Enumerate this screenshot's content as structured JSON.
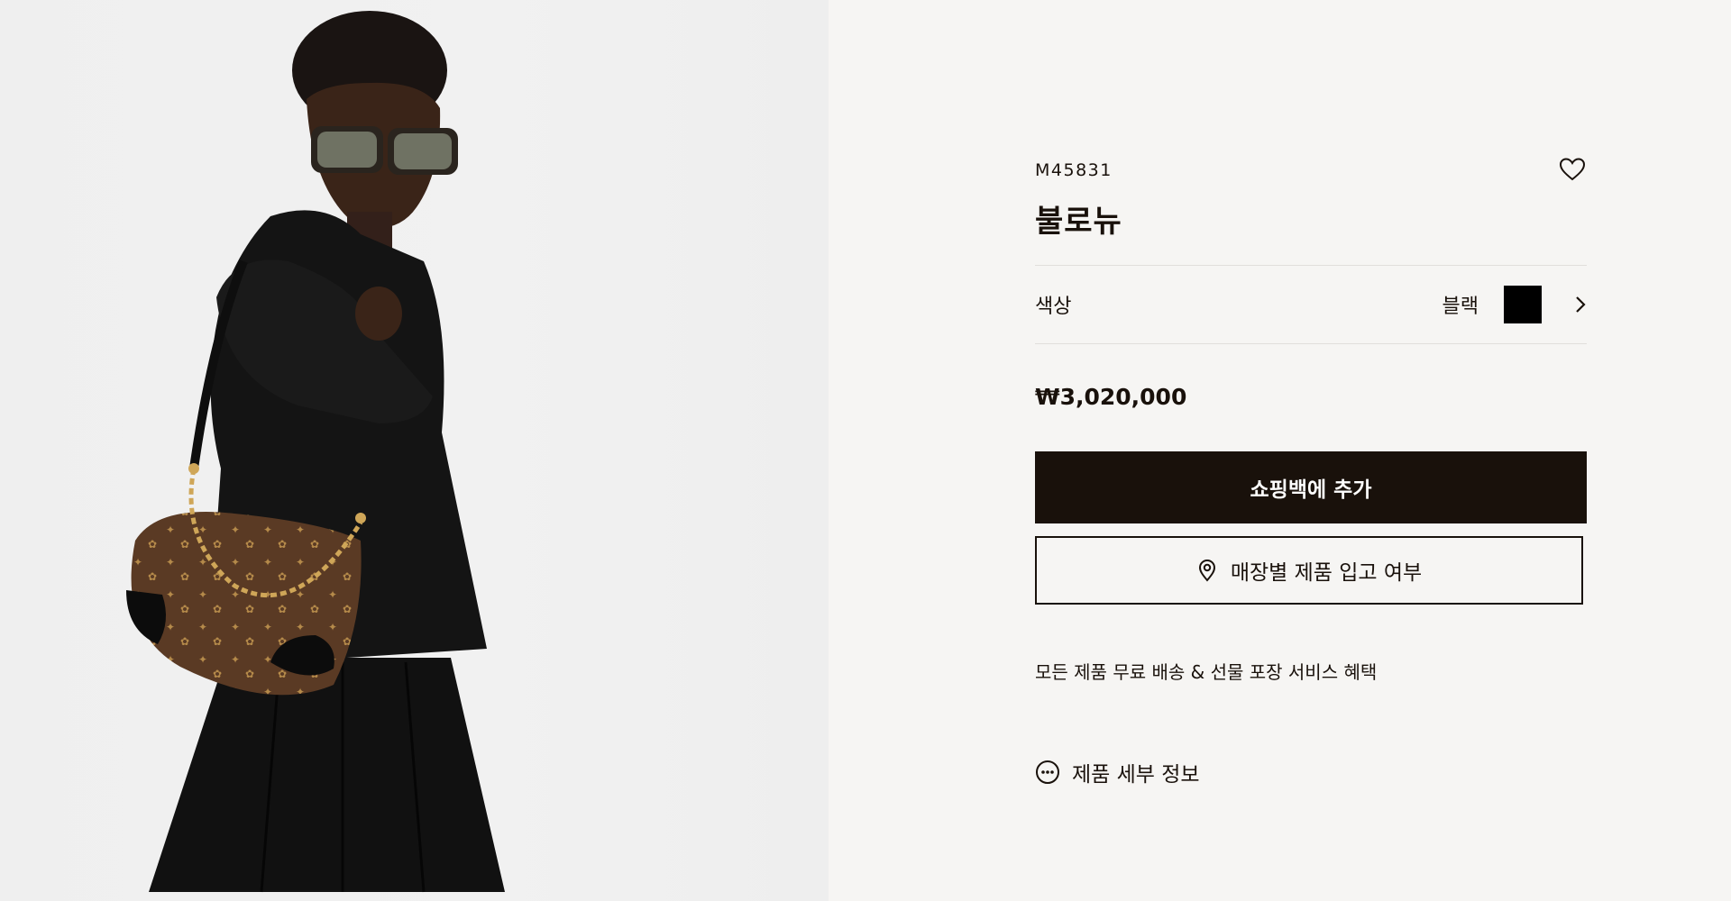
{
  "product": {
    "sku": "M45831",
    "name": "불로뉴",
    "color_label": "색상",
    "color_value": "블랙",
    "color_swatch": "#000000",
    "price": "₩3,020,000",
    "add_to_bag_label": "쇼핑백에 추가",
    "store_availability_label": "매장별 제품 입고 여부",
    "perks_text": "모든 제품 무료 배송 & 선물 포장 서비스 혜택",
    "details_label": "제품 세부 정보"
  },
  "icons": {
    "wishlist": "heart-icon",
    "color_next": "chevron-right-icon",
    "store": "location-pin-icon",
    "details": "more-dots-icon"
  },
  "colors": {
    "brand_dark": "#19110b",
    "background": "#f6f5f3",
    "divider": "#e1dfdb"
  }
}
